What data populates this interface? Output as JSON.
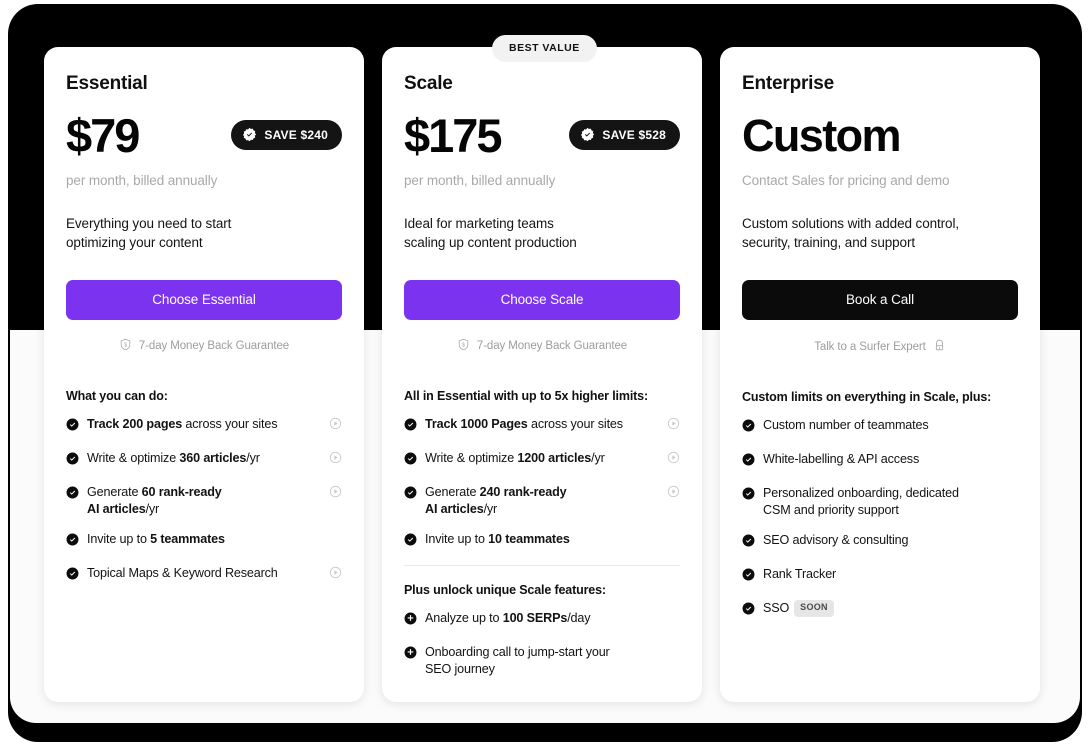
{
  "theme": {
    "accent_purple": "#7c33f0",
    "dark": "#0b0b0b",
    "muted_text": "#a9a9a9",
    "badge_gray": "#e6e6e6"
  },
  "best_value_badge": "BEST VALUE",
  "plans": [
    {
      "id": "essential",
      "name": "Essential",
      "price": "$79",
      "save_badge": "SAVE $240",
      "billing": "per month, billed annually",
      "blurb": "Everything you need to start\noptimizing your content",
      "cta": "Choose Essential",
      "cta_style": "purple",
      "assurance": "7-day Money Back Guarantee",
      "assurance_icon": "money-back-shield-icon",
      "assurance_icon_position": "leading",
      "feature_title": "What you can do:",
      "features": [
        {
          "bullet": "check",
          "html": "<b>Track 200 pages</b> across your sites",
          "play": true
        },
        {
          "bullet": "check",
          "html": "Write &amp; optimize <b>360 articles</b>/yr",
          "play": true
        },
        {
          "bullet": "check",
          "html": "Generate <b>60 rank-ready<br>AI articles</b>/yr",
          "play": true
        },
        {
          "bullet": "check",
          "html": "Invite up to <b>5 teammates</b>",
          "play": false
        },
        {
          "bullet": "check",
          "html": "Topical Maps &amp; Keyword Research",
          "play": true
        }
      ],
      "extra_title": "",
      "extra_features": []
    },
    {
      "id": "scale",
      "name": "Scale",
      "price": "$175",
      "save_badge": "SAVE $528",
      "billing": "per month, billed annually",
      "blurb": "Ideal for marketing teams\nscaling up content production",
      "cta": "Choose Scale",
      "cta_style": "purple",
      "assurance": "7-day Money Back Guarantee",
      "assurance_icon": "money-back-shield-icon",
      "assurance_icon_position": "leading",
      "feature_title": "All in Essential with up to 5x higher limits:",
      "features": [
        {
          "bullet": "check",
          "html": "<b>Track 1000 Pages</b> across your sites",
          "play": true
        },
        {
          "bullet": "check",
          "html": "Write &amp; optimize <b>1200 articles</b>/yr",
          "play": true
        },
        {
          "bullet": "check",
          "html": "Generate <b>240 rank-ready<br>AI articles</b>/yr",
          "play": true
        },
        {
          "bullet": "check",
          "html": "Invite up to <b>10 teammates</b>",
          "play": false
        }
      ],
      "extra_title": "Plus unlock unique Scale features:",
      "extra_features": [
        {
          "bullet": "plus",
          "html": "Analyze up to <b>100 SERPs</b>/day",
          "play": false
        },
        {
          "bullet": "plus",
          "html": "Onboarding call to jump-start your<br>SEO journey",
          "play": false
        }
      ]
    },
    {
      "id": "enterprise",
      "name": "Enterprise",
      "price": "Custom",
      "save_badge": "",
      "billing": "Contact Sales for pricing and demo",
      "blurb": "Custom solutions with added control,\nsecurity, training, and support",
      "cta": "Book a Call",
      "cta_style": "dark",
      "assurance": "Talk to a Surfer Expert",
      "assurance_icon": "surfer-expert-icon",
      "assurance_icon_position": "trailing",
      "feature_title": "Custom limits on everything in Scale, plus:",
      "features": [
        {
          "bullet": "check",
          "html": "Custom number of teammates",
          "play": false
        },
        {
          "bullet": "check",
          "html": "White-labelling &amp; API access",
          "play": false
        },
        {
          "bullet": "check",
          "html": "Personalized onboarding, dedicated<br>CSM and priority support",
          "play": false
        },
        {
          "bullet": "check",
          "html": "SEO advisory &amp; consulting",
          "play": false
        },
        {
          "bullet": "check",
          "html": "Rank Tracker",
          "play": false
        },
        {
          "bullet": "check",
          "html": "SSO<span class=\"soon-badge\">SOON</span>",
          "play": false
        }
      ],
      "extra_title": "",
      "extra_features": []
    }
  ]
}
